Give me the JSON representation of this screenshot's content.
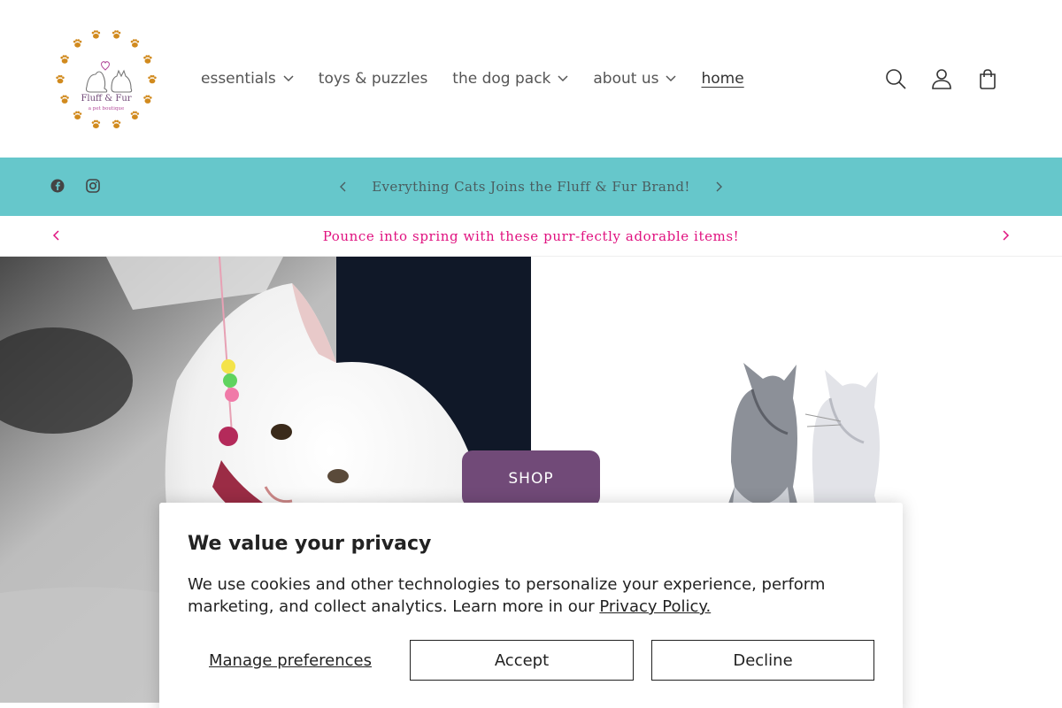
{
  "brand": {
    "name": "Fluff & Fur",
    "tagline": "a pet boutique",
    "logo_color": "#d18a1e"
  },
  "nav": {
    "items": [
      {
        "label": "essentials",
        "has_dropdown": true
      },
      {
        "label": "toys & puzzles",
        "has_dropdown": false
      },
      {
        "label": "the dog pack",
        "has_dropdown": true
      },
      {
        "label": "about us",
        "has_dropdown": true
      },
      {
        "label": "home",
        "has_dropdown": false,
        "active": true
      }
    ]
  },
  "header_icons": [
    "search-icon",
    "account-icon",
    "cart-icon"
  ],
  "announcement_primary": {
    "text": "Everything Cats Joins the Fluff & Fur Brand!",
    "background": "#66c7cb",
    "social": [
      "facebook-icon",
      "instagram-icon"
    ]
  },
  "announcement_secondary": {
    "text": "Pounce into spring with these purr-fectly adorable items!",
    "color": "#e0117f"
  },
  "hero": {
    "button_label": "SHOP",
    "button_color": "#714a78"
  },
  "cookie_banner": {
    "title": "We value your privacy",
    "body": "We use cookies and other technologies to personalize your experience, perform marketing, and collect analytics. Learn more in our ",
    "link_text": "Privacy Policy.",
    "manage_label": "Manage preferences",
    "accept_label": "Accept",
    "decline_label": "Decline"
  }
}
